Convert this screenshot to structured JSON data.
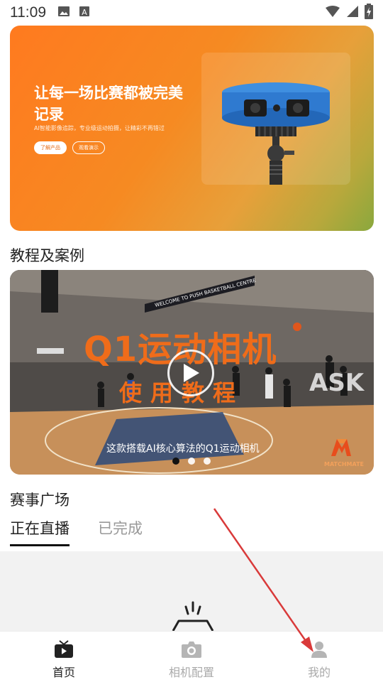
{
  "status_bar": {
    "time": "11:09",
    "left_icons": [
      "image-icon",
      "font-icon"
    ],
    "right_icons": [
      "wifi-icon",
      "signal-icon",
      "battery-icon"
    ]
  },
  "hero": {
    "title": "让每一场比赛都被完美记录",
    "subtitle": "AI智能影像追踪，专业级运动拍摄，让精彩不再错过",
    "button_primary": "了解产品",
    "button_secondary": "观看演示"
  },
  "tutorials": {
    "section_title": "教程及案例",
    "video": {
      "title": "Q1运动相机",
      "subtitle": "使用教程",
      "caption": "这款搭载AI核心算法的Q1运动相机",
      "logo_text": "MATCHMATE",
      "banner_text": "WELCOME TO PUSH BASKETBALL CENTRE"
    },
    "carousel_total": 3,
    "carousel_active": 1
  },
  "events": {
    "section_title": "赛事广场",
    "tabs": [
      "正在直播",
      "已完成"
    ],
    "active_tab": 0
  },
  "bottom_nav": {
    "items": [
      {
        "label": "首页",
        "icon": "tv-icon",
        "active": true
      },
      {
        "label": "相机配置",
        "icon": "camera-icon",
        "active": false
      },
      {
        "label": "我的",
        "icon": "user-icon",
        "active": false
      }
    ]
  },
  "colors": {
    "accent_orange": "#ef6c1a",
    "annotation_red": "#d93a3a"
  }
}
